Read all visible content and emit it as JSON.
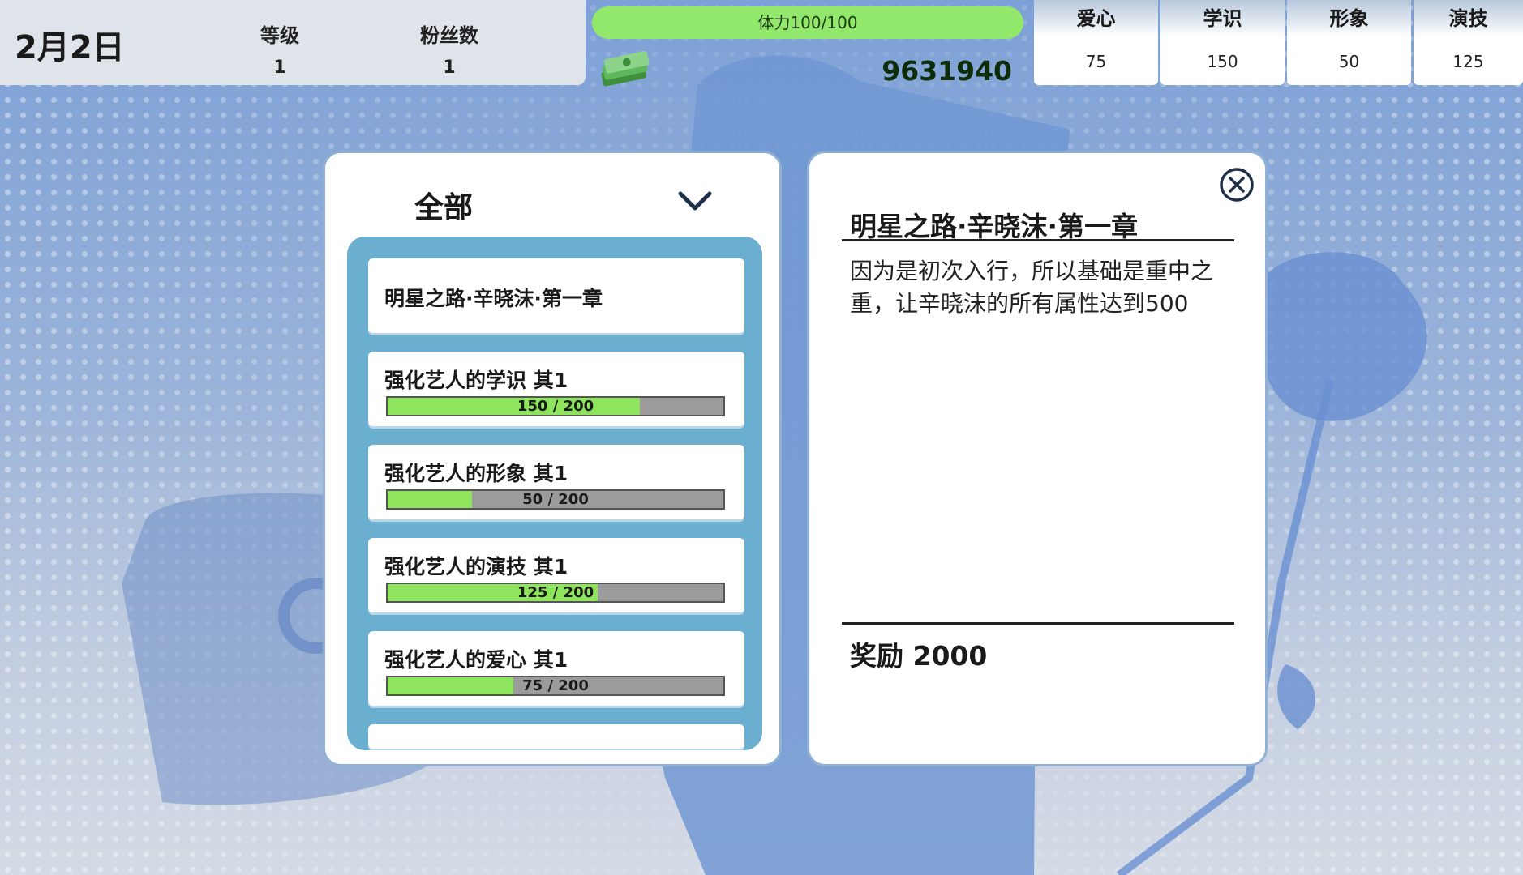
{
  "hud": {
    "date": "2月2日",
    "level_label": "等级",
    "level_value": "1",
    "fans_label": "粉丝数",
    "fans_value": "1",
    "stamina": "体力100/100",
    "money": "9631940",
    "money_icon": "cash-stack-icon"
  },
  "attributes": [
    {
      "label": "爱心",
      "value": "75"
    },
    {
      "label": "学识",
      "value": "150"
    },
    {
      "label": "形象",
      "value": "50"
    },
    {
      "label": "演技",
      "value": "125"
    }
  ],
  "quest_list": {
    "filter": "全部",
    "items": [
      {
        "title": "明星之路·辛晓沫·第一章"
      },
      {
        "title": "强化艺人的学识 其1",
        "progress_text": "150 / 200",
        "progress": 0.75
      },
      {
        "title": "强化艺人的形象 其1",
        "progress_text": "50 / 200",
        "progress": 0.25
      },
      {
        "title": "强化艺人的演技 其1",
        "progress_text": "125 / 200",
        "progress": 0.625
      },
      {
        "title": "强化艺人的爱心 其1",
        "progress_text": "75 / 200",
        "progress": 0.375
      }
    ]
  },
  "detail": {
    "title": "明星之路·辛晓沫·第一章",
    "description": "因为是初次入行，所以基础是重中之重，让辛晓沫的所有属性达到500",
    "reward": "奖励 2000"
  },
  "colors": {
    "progress_fill": "#8ee45c",
    "stamina": "#92e86a",
    "list_frame": "#6aaed0"
  }
}
